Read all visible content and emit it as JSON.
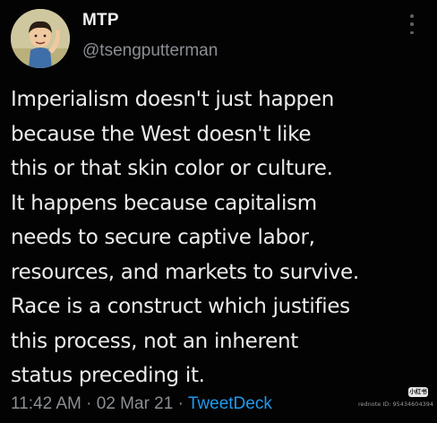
{
  "author": {
    "display_name": "MTP",
    "handle": "@tsengputterman"
  },
  "tweet": {
    "lines": [
      "Imperialism doesn't just happen",
      "because the West doesn't like",
      "this or that skin color or culture.",
      "It happens because capitalism",
      "needs to secure captive labor,",
      "resources, and markets to survive.",
      "Race is a construct which justifies",
      "this process, not an inherent",
      "status preceding it."
    ],
    "time": "11:42 AM",
    "separator": "·",
    "date": "02 Mar 21",
    "source": "TweetDeck"
  },
  "icons": {
    "avatar": "avatar-cartoon-character",
    "more": "more-vertical-icon"
  },
  "watermark": {
    "logo_text": "小红书",
    "id_text": "rednote ID: 95434604394"
  },
  "colors": {
    "background": "#030303",
    "text": "#ececec",
    "muted": "#8b8f94",
    "link": "#1d9bf0"
  }
}
